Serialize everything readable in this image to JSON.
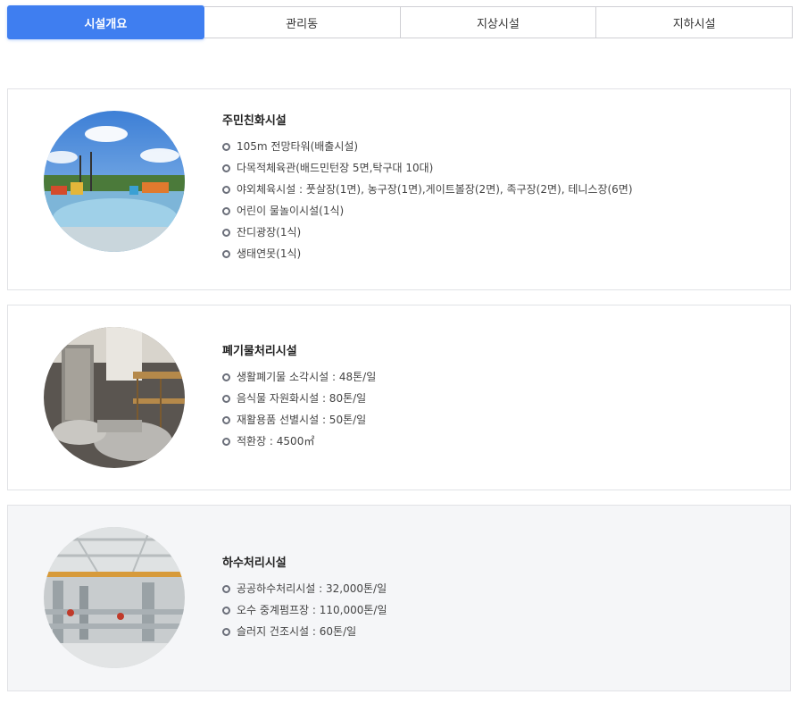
{
  "tabs": [
    {
      "label": "시설개요",
      "active": true
    },
    {
      "label": "관리동",
      "active": false
    },
    {
      "label": "지상시설",
      "active": false
    },
    {
      "label": "지하시설",
      "active": false
    }
  ],
  "sections": [
    {
      "title": "주민친화시설",
      "items": [
        "105m 전망타워(배출시설)",
        "다목적체육관(배드민턴장 5면,탁구대 10대)",
        "야외체육시설 : 풋살장(1면), 농구장(1면),게이트볼장(2면), 족구장(2면), 테니스장(6면)",
        "어린이 물놀이시설(1식)",
        "잔디광장(1식)",
        "생태연못(1식)"
      ]
    },
    {
      "title": "폐기물처리시설",
      "items": [
        "생활폐기물 소각시설 : 48톤/일",
        "음식물 자원화시설 : 80톤/일",
        "재활용품 선별시설 : 50톤/일",
        "적환장 : 4500㎡"
      ]
    },
    {
      "title": "하수처리시설",
      "items": [
        "공공하수처리시설 : 32,000톤/일",
        "오수 중계펌프장 : 110,000톤/일",
        "슬러지 건조시설 : 60톤/일"
      ]
    }
  ],
  "colors": {
    "accent": "#3f7ef0",
    "border": "#e1e2e6",
    "gray_bg": "#f5f6f8"
  }
}
